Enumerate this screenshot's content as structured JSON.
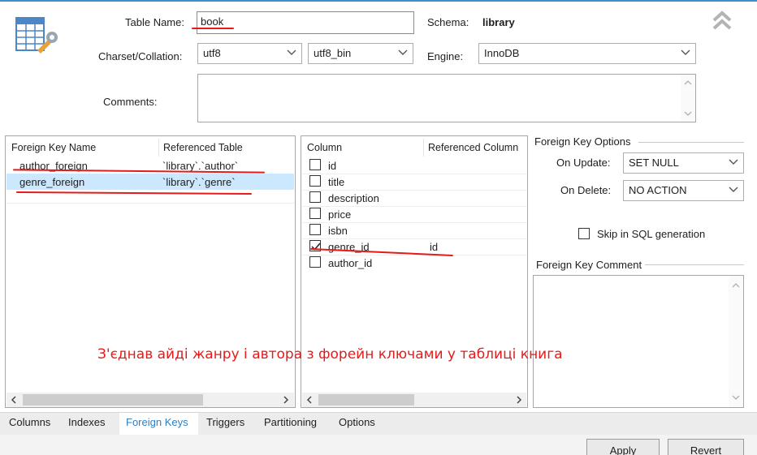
{
  "header": {
    "table_name_label": "Table Name:",
    "table_name_value": "book",
    "schema_label": "Schema:",
    "schema_value": "library",
    "charset_label": "Charset/Collation:",
    "charset_value": "utf8",
    "collation_value": "utf8_bin",
    "engine_label": "Engine:",
    "engine_value": "InnoDB",
    "comments_label": "Comments:",
    "comments_value": ""
  },
  "fk_list": {
    "col_name": "Foreign Key Name",
    "col_ref_table": "Referenced Table",
    "rows": [
      {
        "name": "author_foreign",
        "ref_table": "`library`.`author`",
        "selected": false
      },
      {
        "name": "genre_foreign",
        "ref_table": "`library`.`genre`",
        "selected": true
      }
    ]
  },
  "columns_list": {
    "col_column": "Column",
    "col_ref_column": "Referenced Column",
    "rows": [
      {
        "name": "id",
        "checked": false,
        "ref": ""
      },
      {
        "name": "title",
        "checked": false,
        "ref": ""
      },
      {
        "name": "description",
        "checked": false,
        "ref": ""
      },
      {
        "name": "price",
        "checked": false,
        "ref": ""
      },
      {
        "name": "isbn",
        "checked": false,
        "ref": ""
      },
      {
        "name": "genre_id",
        "checked": true,
        "ref": "id"
      },
      {
        "name": "author_id",
        "checked": false,
        "ref": ""
      }
    ]
  },
  "fk_options": {
    "title": "Foreign Key Options",
    "on_update_label": "On Update:",
    "on_update_value": "SET NULL",
    "on_delete_label": "On Delete:",
    "on_delete_value": "NO ACTION",
    "skip_label": "Skip in SQL generation",
    "skip_checked": false,
    "comment_title": "Foreign Key Comment",
    "comment_value": ""
  },
  "annotation": "З'єднав айді жанру і автора з форейн ключами у таблиці книга",
  "tabs": [
    {
      "label": "Columns",
      "active": false
    },
    {
      "label": "Indexes",
      "active": false
    },
    {
      "label": "Foreign Keys",
      "active": true
    },
    {
      "label": "Triggers",
      "active": false
    },
    {
      "label": "Partitioning",
      "active": false
    },
    {
      "label": "Options",
      "active": false
    }
  ],
  "buttons": {
    "apply": "Apply",
    "revert": "Revert"
  },
  "colors": {
    "annotation_red": "#e31b1b",
    "active_tab": "#2e7ec2",
    "selection": "#cce8ff"
  },
  "icons": [
    "table-editor-icon",
    "collapse-chevrons-icon",
    "chevron-down-icon",
    "checkmark-icon",
    "scroll-left-icon",
    "scroll-right-icon",
    "scroll-up-icon",
    "scroll-down-icon"
  ]
}
